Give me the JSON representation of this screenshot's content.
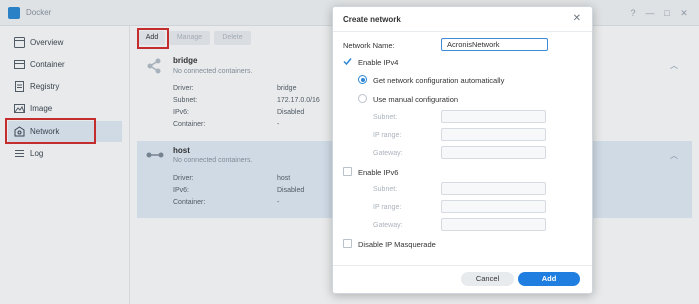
{
  "app": {
    "title": "Docker"
  },
  "window_controls": [
    "?",
    "—",
    "□",
    "✕"
  ],
  "sidebar": {
    "items": [
      {
        "label": "Overview",
        "icon": "overview-icon"
      },
      {
        "label": "Container",
        "icon": "container-icon"
      },
      {
        "label": "Registry",
        "icon": "registry-icon"
      },
      {
        "label": "Image",
        "icon": "image-icon"
      },
      {
        "label": "Network",
        "icon": "network-icon",
        "active": true
      },
      {
        "label": "Log",
        "icon": "log-icon"
      }
    ]
  },
  "toolbar": {
    "add": "Add",
    "manage": "Manage",
    "delete": "Delete"
  },
  "networks": [
    {
      "name": "bridge",
      "status": "No connected containers.",
      "rows": [
        {
          "key": "Driver:",
          "value": "bridge"
        },
        {
          "key": "Subnet:",
          "value": "172.17.0.0/16"
        },
        {
          "key": "IPv6:",
          "value": "Disabled"
        },
        {
          "key": "Container:",
          "value": "-"
        }
      ]
    },
    {
      "name": "host",
      "status": "No connected containers.",
      "rows": [
        {
          "key": "Driver:",
          "value": "host"
        },
        {
          "key": "IPv6:",
          "value": "Disabled"
        },
        {
          "key": "Container:",
          "value": "-"
        }
      ]
    }
  ],
  "dialog": {
    "title": "Create network",
    "network_name_label": "Network Name:",
    "network_name_value": "AcronisNetwork",
    "enable_ipv4": "Enable IPv4",
    "auto_config": "Get network configuration automatically",
    "manual_config": "Use manual configuration",
    "ipv4_fields": [
      "Subnet:",
      "IP range:",
      "Gateway:"
    ],
    "enable_ipv6": "Enable IPv6",
    "ipv6_fields": [
      "Subnet:",
      "IP range:",
      "Gateway:"
    ],
    "disable_masquerade": "Disable IP Masquerade",
    "cancel": "Cancel",
    "add": "Add"
  }
}
